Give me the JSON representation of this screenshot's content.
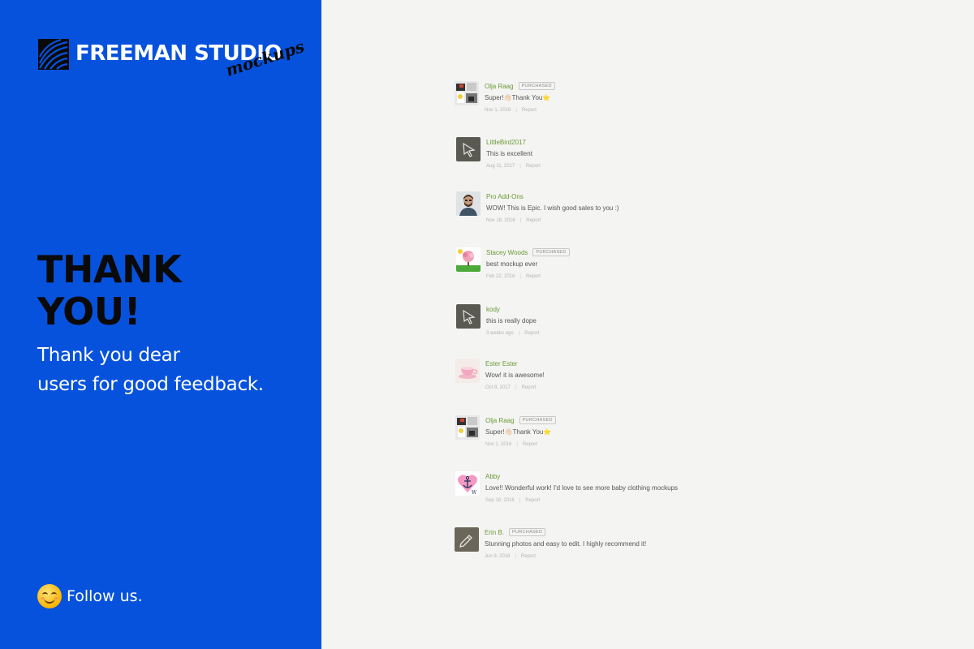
{
  "brand": {
    "name": "FREEMAN STUDIO",
    "sub": "mockups",
    "logo_icon": "stripes-logo-icon"
  },
  "hero": {
    "title_line1": "THANK",
    "title_line2": "YOU!",
    "subtitle_line1": "Thank you dear",
    "subtitle_line2": "users for good feedback."
  },
  "follow": {
    "icon": "smile-emoji-icon",
    "label": "Follow us."
  },
  "colors": {
    "panel_blue": "#0652dd",
    "page_bg": "#f4f4f2",
    "username_green": "#6a9a38"
  },
  "reviews": [
    {
      "name": "Olja Raag",
      "badge": "PURCHASED",
      "comment": "Super!👋🏻Thank You⭐",
      "date": "Nov 1, 2016",
      "sep": "|",
      "report": "Report",
      "avatar": "collage-avatar-icon"
    },
    {
      "name": "LittleBird2017",
      "badge": "",
      "comment": "This is excellent",
      "date": "Aug 11, 2017",
      "sep": "|",
      "report": "Report",
      "avatar": "cursor-avatar-icon"
    },
    {
      "name": "Pro Add-Ons",
      "badge": "",
      "comment": "WOW! This is Epic. I wish good sales to you :)",
      "date": "Nov 18, 2016",
      "sep": "|",
      "report": "Report",
      "avatar": "man-photo-avatar-icon"
    },
    {
      "name": "Stacey Woods",
      "badge": "PURCHASED",
      "comment": "best mockup ever",
      "date": "Feb 22, 2018",
      "sep": "|",
      "report": "Report",
      "avatar": "tree-avatar-icon"
    },
    {
      "name": "kody",
      "badge": "",
      "comment": "this is really dope",
      "date": "3 weeks ago",
      "sep": "|",
      "report": "Report",
      "avatar": "cursor-avatar-icon"
    },
    {
      "name": "Ester Ester",
      "badge": "",
      "comment": "Wow! it is awesome!",
      "date": "Oct 9, 2017",
      "sep": "|",
      "report": "Report",
      "avatar": "teacup-avatar-icon"
    },
    {
      "name": "Olja Raag",
      "badge": "PURCHASED",
      "comment": "Super!👋🏻Thank You⭐",
      "date": "Nov 1, 2016",
      "sep": "|",
      "report": "Report",
      "avatar": "collage-avatar-icon"
    },
    {
      "name": "Abby",
      "badge": "",
      "comment": "Love!! Wonderful work! I'd love to see more baby clothing mockups",
      "date": "Sep 18, 2016",
      "sep": "|",
      "report": "Report",
      "avatar": "heart-anchor-avatar-icon"
    },
    {
      "name": "Erin B.",
      "badge": "PURCHASED",
      "comment": "Stunning photos and easy to edit. I highly recommend it!",
      "date": "Jun 9, 2018",
      "sep": "|",
      "report": "Report",
      "avatar": "pencil-avatar-icon"
    }
  ]
}
